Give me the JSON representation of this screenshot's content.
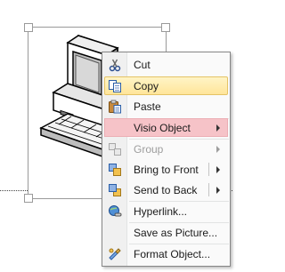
{
  "menu": {
    "items": [
      {
        "id": "cut",
        "label": "Cut",
        "icon": "scissors-icon"
      },
      {
        "id": "copy",
        "label": "Copy",
        "icon": "copy-icon"
      },
      {
        "id": "paste",
        "label": "Paste",
        "icon": "paste-icon"
      },
      {
        "id": "visio_object",
        "label": "Visio Object",
        "submenu": true
      },
      {
        "id": "group",
        "label": "Group",
        "icon": "group-icon",
        "submenu": true,
        "disabled": true
      },
      {
        "id": "bring_to_front",
        "label": "Bring to Front",
        "icon": "bring-to-front-icon",
        "submenu": true
      },
      {
        "id": "send_to_back",
        "label": "Send to Back",
        "icon": "send-to-back-icon",
        "submenu": true
      },
      {
        "id": "hyperlink",
        "label": "Hyperlink...",
        "icon": "hyperlink-icon"
      },
      {
        "id": "save_as_picture",
        "label": "Save as Picture..."
      },
      {
        "id": "format_object",
        "label": "Format Object...",
        "icon": "format-object-icon"
      }
    ]
  },
  "colors": {
    "hover_item": "#ffe59a",
    "open_submenu_item": "#f6c3c8",
    "menu_border": "#868686"
  }
}
